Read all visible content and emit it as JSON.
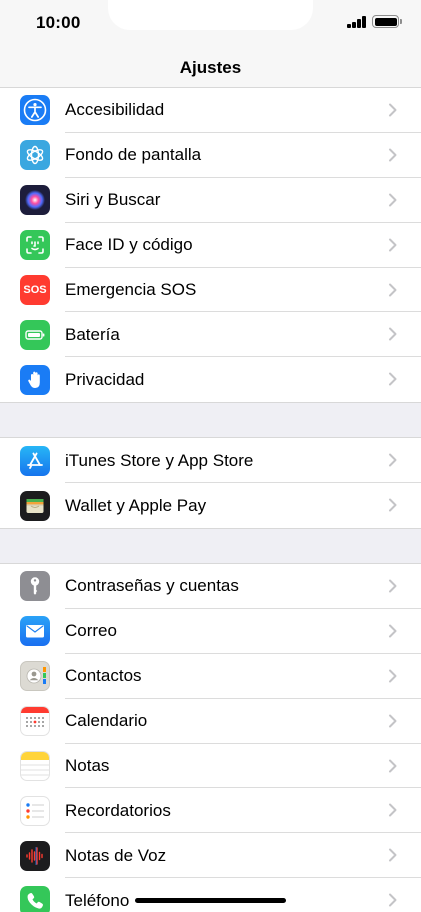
{
  "status_bar": {
    "time": "10:00"
  },
  "nav": {
    "title": "Ajustes"
  },
  "groups": [
    {
      "items": [
        {
          "label": "Accesibilidad",
          "icon": "accessibility-icon",
          "color": "#1a7cf5"
        },
        {
          "label": "Fondo de pantalla",
          "icon": "wallpaper-icon",
          "color": "#3aa7e0"
        },
        {
          "label": "Siri y Buscar",
          "icon": "siri-icon",
          "color": "#1d1d3b"
        },
        {
          "label": "Face ID y código",
          "icon": "face-id-icon",
          "color": "#34c759"
        },
        {
          "label": "Emergencia SOS",
          "icon": "sos-icon",
          "color": "#ff3b30",
          "icon_text": "SOS"
        },
        {
          "label": "Batería",
          "icon": "battery-icon",
          "color": "#34c759"
        },
        {
          "label": "Privacidad",
          "icon": "hand-icon",
          "color": "#1a7cf5"
        }
      ]
    },
    {
      "items": [
        {
          "label": "iTunes Store y App Store",
          "icon": "app-store-icon",
          "color": "#1a8cf5"
        },
        {
          "label": "Wallet y Apple Pay",
          "icon": "wallet-icon",
          "color": "#1c1c1e"
        }
      ]
    },
    {
      "items": [
        {
          "label": "Contraseñas y cuentas",
          "icon": "key-icon",
          "color": "#8e8e93"
        },
        {
          "label": "Correo",
          "icon": "mail-icon",
          "color": "#1e88f0"
        },
        {
          "label": "Contactos",
          "icon": "contacts-icon",
          "color": "#d8d6d0"
        },
        {
          "label": "Calendario",
          "icon": "calendar-icon",
          "color": "#ffffff"
        },
        {
          "label": "Notas",
          "icon": "notes-icon",
          "color": "#ffffff"
        },
        {
          "label": "Recordatorios",
          "icon": "reminders-icon",
          "color": "#ffffff"
        },
        {
          "label": "Notas de Voz",
          "icon": "voice-memos-icon",
          "color": "#1c1c1e"
        },
        {
          "label": "Teléfono",
          "icon": "phone-icon",
          "color": "#34c759"
        }
      ]
    }
  ]
}
